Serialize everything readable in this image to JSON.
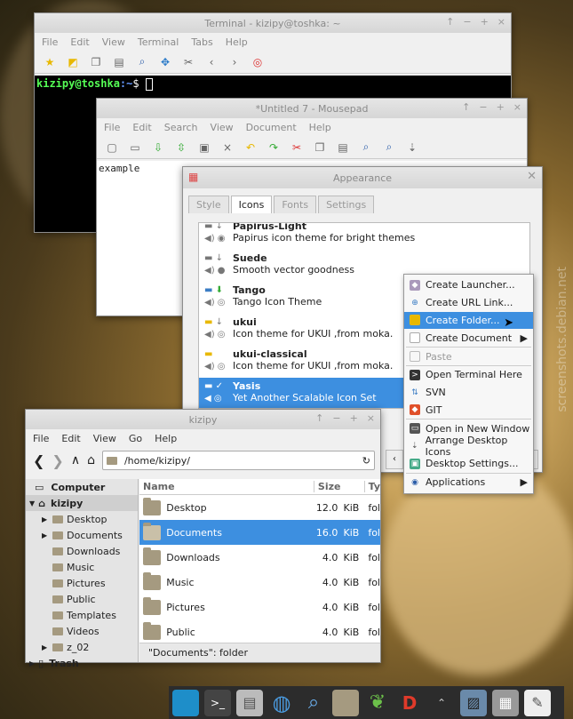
{
  "terminal": {
    "title": "Terminal - kizipy@toshka: ~",
    "menu": [
      "File",
      "Edit",
      "View",
      "Terminal",
      "Tabs",
      "Help"
    ],
    "prompt_user": "kizipy@toshka",
    "prompt_path": ":~",
    "prompt_symbol": "$"
  },
  "mousepad": {
    "title": "*Untitled 7 - Mousepad",
    "menu": [
      "File",
      "Edit",
      "Search",
      "View",
      "Document",
      "Help"
    ],
    "text": "example"
  },
  "appearance": {
    "title": "Appearance",
    "tabs": [
      "Style",
      "Icons",
      "Fonts",
      "Settings"
    ],
    "themes": [
      {
        "name": "Papirus-Light",
        "desc": "Papirus icon theme for bright themes"
      },
      {
        "name": "Suede",
        "desc": "Smooth vector goodness"
      },
      {
        "name": "Tango",
        "desc": "Tango Icon Theme"
      },
      {
        "name": "ukui",
        "desc": "Icon theme for UKUI ,from moka."
      },
      {
        "name": "ukui-classical",
        "desc": "Icon theme for UKUI ,from moka."
      },
      {
        "name": "Yasis",
        "desc": "Yet Another Scalable Icon Set"
      }
    ]
  },
  "context_menu": {
    "items": [
      "Create Launcher...",
      "Create URL Link...",
      "Create Folder...",
      "Create Document",
      "Paste",
      "Open Terminal Here",
      "SVN",
      "GIT",
      "Open in New Window",
      "Arrange Desktop Icons",
      "Desktop Settings...",
      "Applications"
    ]
  },
  "filemanager": {
    "title": "kizipy",
    "menu": [
      "File",
      "Edit",
      "View",
      "Go",
      "Help"
    ],
    "path": "/home/kizipy/",
    "sidebar": [
      "Computer",
      "kizipy",
      "Desktop",
      "Documents",
      "Downloads",
      "Music",
      "Pictures",
      "Public",
      "Templates",
      "Videos",
      "z_02",
      "Trash"
    ],
    "columns": {
      "name": "Name",
      "size": "Size",
      "type": "Ty"
    },
    "rows": [
      {
        "name": "Desktop",
        "size": "12.0",
        "unit": "KiB",
        "type": "fol"
      },
      {
        "name": "Documents",
        "size": "16.0",
        "unit": "KiB",
        "type": "fol"
      },
      {
        "name": "Downloads",
        "size": "4.0",
        "unit": "KiB",
        "type": "fol"
      },
      {
        "name": "Music",
        "size": "4.0",
        "unit": "KiB",
        "type": "fol"
      },
      {
        "name": "Pictures",
        "size": "4.0",
        "unit": "KiB",
        "type": "fol"
      },
      {
        "name": "Public",
        "size": "4.0",
        "unit": "KiB",
        "type": "fol"
      }
    ],
    "status": "\"Documents\": folder"
  },
  "watermark": "screenshots.debian.net"
}
